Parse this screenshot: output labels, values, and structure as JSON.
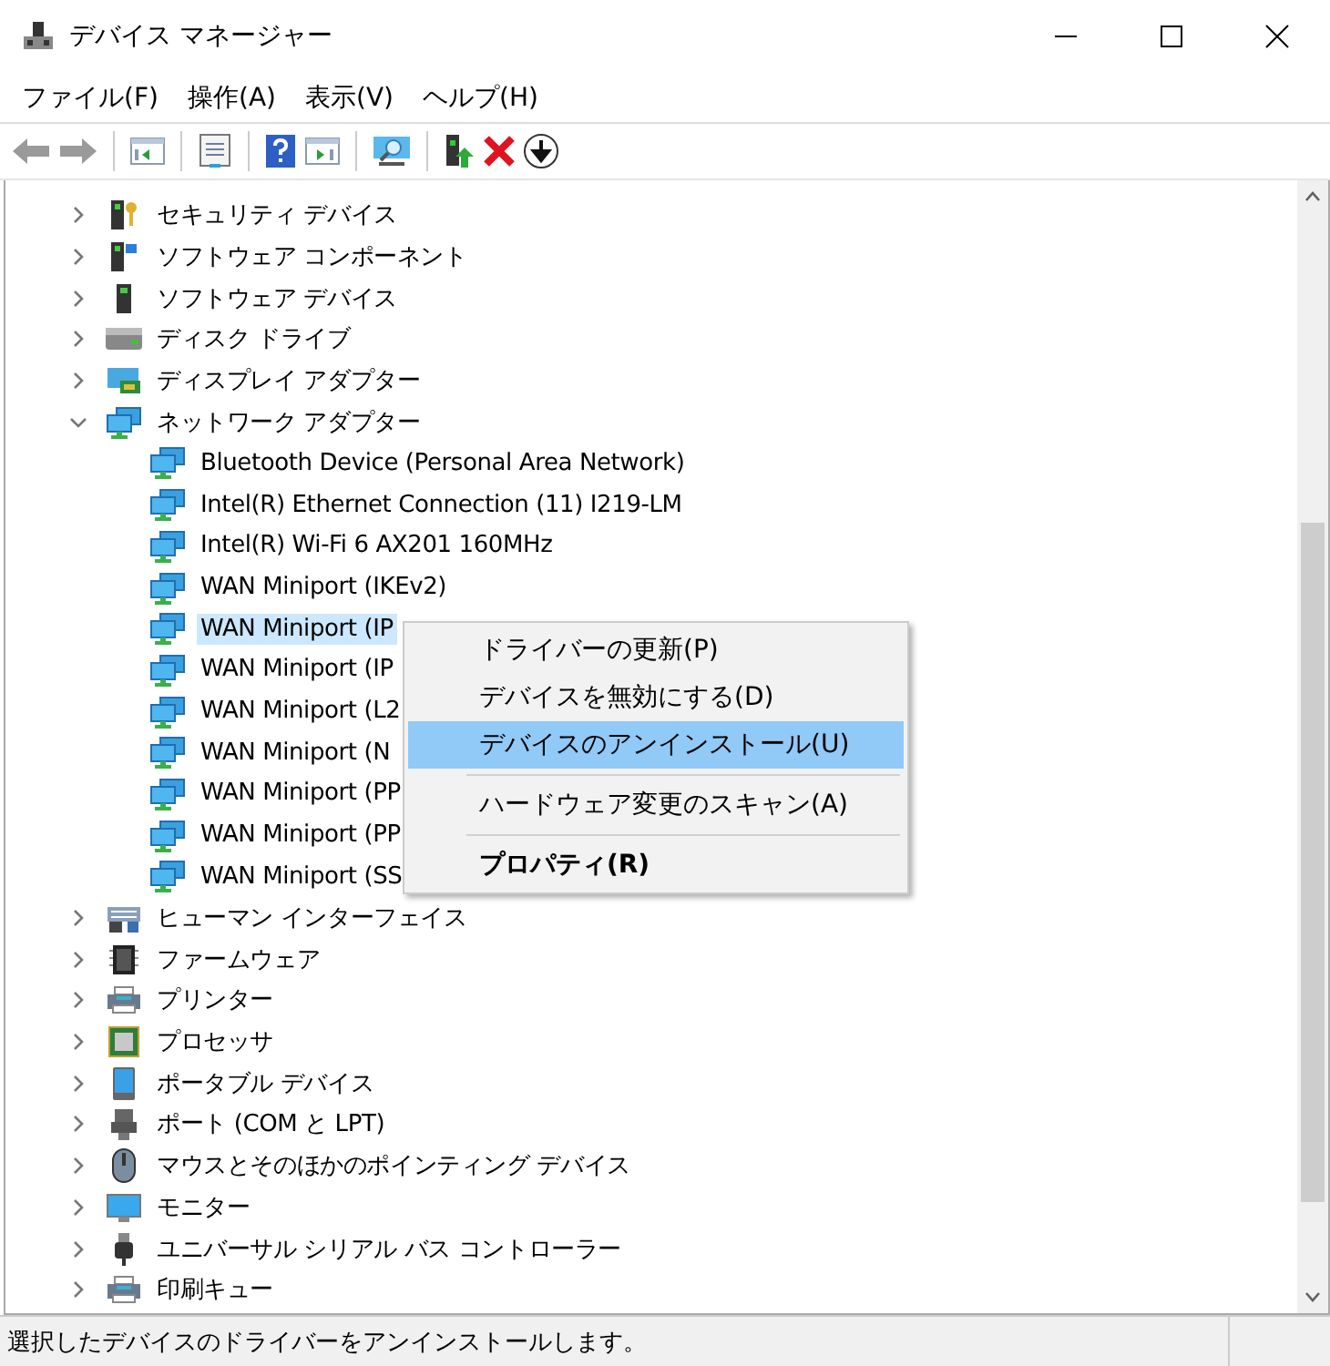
{
  "window": {
    "title": "デバイス マネージャー"
  },
  "menu_bar": [
    "ファイル(F)",
    "操作(A)",
    "表示(V)",
    "ヘルプ(H)"
  ],
  "toolbar": [
    {
      "kind": "back",
      "disabled": true
    },
    {
      "kind": "forward",
      "disabled": true
    },
    {
      "kind": "sep"
    },
    {
      "kind": "tree"
    },
    {
      "kind": "sep"
    },
    {
      "kind": "props"
    },
    {
      "kind": "sep"
    },
    {
      "kind": "help"
    },
    {
      "kind": "pane"
    },
    {
      "kind": "sep"
    },
    {
      "kind": "scan"
    },
    {
      "kind": "sep"
    },
    {
      "kind": "update"
    },
    {
      "kind": "remove"
    },
    {
      "kind": "down"
    }
  ],
  "tree": [
    {
      "label": "セキュリティ デバイス",
      "kind": "security",
      "expanded": false
    },
    {
      "label": "ソフトウェア コンポーネント",
      "kind": "component",
      "expanded": false
    },
    {
      "label": "ソフトウェア デバイス",
      "kind": "software",
      "expanded": false
    },
    {
      "label": "ディスク ドライブ",
      "kind": "disk",
      "expanded": false
    },
    {
      "label": "ディスプレイ アダプター",
      "kind": "display",
      "expanded": false
    },
    {
      "label": "ネットワーク アダプター",
      "kind": "network",
      "expanded": true,
      "children": [
        {
          "label": "Bluetooth Device (Personal Area Network)",
          "selected": false
        },
        {
          "label": "Intel(R) Ethernet Connection (11) I219-LM",
          "selected": false
        },
        {
          "label": "Intel(R) Wi-Fi 6 AX201 160MHz",
          "selected": false
        },
        {
          "label": "WAN Miniport (IKEv2)",
          "selected": false
        },
        {
          "label": "WAN Miniport (IP",
          "selected": true
        },
        {
          "label": "WAN Miniport (IP",
          "selected": false
        },
        {
          "label": "WAN Miniport (L2",
          "selected": false
        },
        {
          "label": "WAN Miniport (N",
          "selected": false
        },
        {
          "label": "WAN Miniport (PP",
          "selected": false
        },
        {
          "label": "WAN Miniport (PP",
          "selected": false
        },
        {
          "label": "WAN Miniport (SS",
          "selected": false
        }
      ]
    },
    {
      "label": "ヒューマン インターフェイス",
      "kind": "hid",
      "expanded": false
    },
    {
      "label": "ファームウェア",
      "kind": "firmware",
      "expanded": false
    },
    {
      "label": "プリンター",
      "kind": "printer",
      "expanded": false
    },
    {
      "label": "プロセッサ",
      "kind": "processor",
      "expanded": false
    },
    {
      "label": "ポータブル デバイス",
      "kind": "portable",
      "expanded": false
    },
    {
      "label": "ポート (COM と LPT)",
      "kind": "port",
      "expanded": false
    },
    {
      "label": "マウスとそのほかのポインティング デバイス",
      "kind": "mouse",
      "expanded": false
    },
    {
      "label": "モニター",
      "kind": "monitor",
      "expanded": false
    },
    {
      "label": "ユニバーサル シリアル バス コントローラー",
      "kind": "usb",
      "expanded": false
    },
    {
      "label": "印刷キュー",
      "kind": "printer",
      "expanded": false
    }
  ],
  "context_menu": [
    {
      "kind": "item",
      "label": "ドライバーの更新(P)",
      "selected": false,
      "default": false
    },
    {
      "kind": "item",
      "label": "デバイスを無効にする(D)",
      "selected": false,
      "default": false
    },
    {
      "kind": "item",
      "label": "デバイスのアンインストール(U)",
      "selected": true,
      "default": false
    },
    {
      "kind": "separator"
    },
    {
      "kind": "item",
      "label": "ハードウェア変更のスキャン(A)",
      "selected": false,
      "default": false
    },
    {
      "kind": "separator"
    },
    {
      "kind": "item",
      "label": "プロパティ(R)",
      "selected": false,
      "default": true
    }
  ],
  "status_bar": "選択したデバイスのドライバーをアンインストールします。"
}
